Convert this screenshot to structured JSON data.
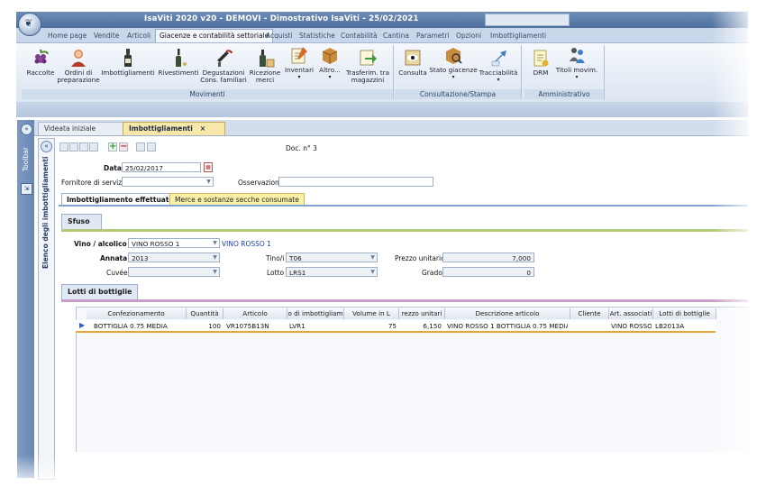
{
  "window": {
    "title": "IsaViti 2020 v20 - DEMOVI - Dimostrativo IsaViti - 25/02/2021"
  },
  "menu_tabs": [
    {
      "label": "Home page"
    },
    {
      "label": "Vendite"
    },
    {
      "label": "Articoli"
    },
    {
      "label": "Giacenze e contabilità settoriale",
      "active": true
    },
    {
      "label": "Acquisti"
    },
    {
      "label": "Statistiche"
    },
    {
      "label": "Contabilità"
    },
    {
      "label": "Cantina"
    },
    {
      "label": "Parametri"
    },
    {
      "label": "Opzioni"
    },
    {
      "label": "Imbottigliamenti"
    }
  ],
  "ribbon": {
    "movimenti": {
      "label": "Movimenti",
      "buttons": [
        "Raccolte",
        "Ordini di preparazione",
        "Imbottigliamenti",
        "Rivestimenti",
        "Degustazioni Cons. familiari",
        "Ricezione merci",
        "Inventari",
        "Altro...",
        "Trasferim. tra magazzini"
      ]
    },
    "consultazione": {
      "label": "Consultazione/Stampa",
      "buttons": [
        "Consulta",
        "Stato giacenze",
        "Tracciabilità"
      ]
    },
    "amministrativo": {
      "label": "Amministrativo",
      "buttons": [
        "DRM",
        "Titoli movim."
      ]
    }
  },
  "sidebar": {
    "toolbar_label": "Toolbar",
    "elenco_label": "Elenco degli imbottigliamenti"
  },
  "doc_tabs": [
    {
      "label": "Videata iniziale"
    },
    {
      "label": "Imbottigliamenti",
      "close": "×"
    }
  ],
  "form": {
    "doc_number": "Doc. n° 3",
    "data_label": "Data",
    "data_value": "25/02/2017",
    "fornitore_label": "Fornitore di servizi",
    "fornitore_value": "",
    "osservazioni_label": "Osservazioni",
    "osservazioni_value": ""
  },
  "sub_tabs": [
    {
      "label": "Imbottigliamento effettuato"
    },
    {
      "label": "Merce e sostanze secche consumate"
    }
  ],
  "sfuso": {
    "title": "Sfuso",
    "vino_label": "Vino / alcolico",
    "vino_value": "VINO ROSSO 1",
    "vino_desc": "VINO ROSSO 1",
    "annata_label": "Annata",
    "annata_value": "2013",
    "tino_label": "Tino/i",
    "tino_value": "T06",
    "prezzo_label": "Prezzo unitario",
    "prezzo_value": "7,000",
    "cuvee_label": "Cuvée",
    "cuvee_value": "",
    "lotto_label": "Lotto",
    "lotto_value": "LRS1",
    "grado_label": "Grado",
    "grado_value": "0"
  },
  "lotti": {
    "title": "Lotti di bottiglie",
    "columns": [
      "Confezionamento",
      "Quantità",
      "Articolo",
      "o di imbottigliam",
      "Volume in L",
      "rezzo unitari",
      "Descrizione articolo",
      "Cliente",
      "Art. associati",
      "Lotti di bottiglie"
    ],
    "rows": [
      [
        "BOTTIGLIA 0.75 MEDIA",
        "100",
        "VR1075B13N",
        "LVR1",
        "75",
        "6,150",
        "VINO ROSSO 1 BOTTIGLIA 0.75 MEDIA",
        "",
        "VINO ROSSO",
        "LB2013A"
      ]
    ]
  },
  "colors": {
    "accent": "#4d6e9c",
    "active_tab": "#f7e7a8",
    "row_highlight": "#e8a33a"
  }
}
